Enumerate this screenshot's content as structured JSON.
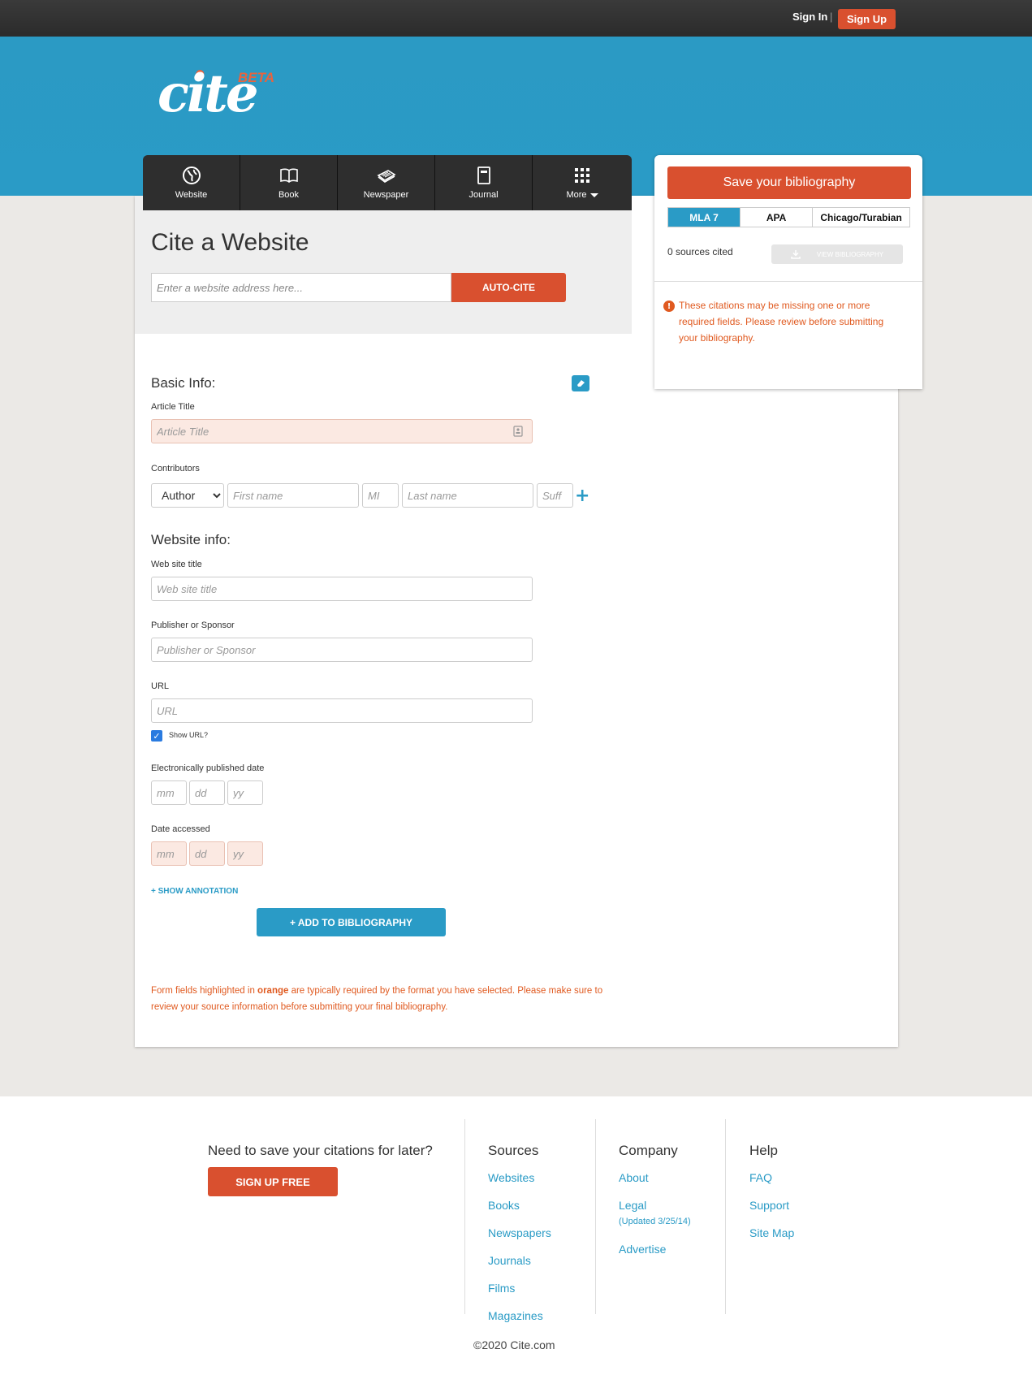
{
  "topbar": {
    "signin": "Sign In",
    "separator": "|",
    "signup": "Sign Up"
  },
  "logo": {
    "text": "cite",
    "badge": "BETA"
  },
  "nav": [
    {
      "label": "Website",
      "icon": "globe-icon"
    },
    {
      "label": "Book",
      "icon": "book-icon"
    },
    {
      "label": "Newspaper",
      "icon": "newspaper-icon"
    },
    {
      "label": "Journal",
      "icon": "journal-icon"
    },
    {
      "label": "More",
      "icon": "grid-icon"
    }
  ],
  "cite": {
    "title": "Cite a Website",
    "url_placeholder": "Enter a website address here...",
    "autocite": "AUTO-CITE"
  },
  "form": {
    "basic_info": "Basic Info:",
    "article_title_label": "Article Title",
    "article_title_placeholder": "Article Title",
    "contributors_label": "Contributors",
    "contributor_role": "Author",
    "first_name": "First name",
    "mi": "MI",
    "last_name": "Last name",
    "suffix": "Suff",
    "website_info": "Website info:",
    "site_title_label": "Web site title",
    "site_title_placeholder": "Web site title",
    "publisher_label": "Publisher or Sponsor",
    "publisher_placeholder": "Publisher or Sponsor",
    "url_label": "URL",
    "url_placeholder": "URL",
    "show_url": "Show URL?",
    "epub_label": "Electronically published date",
    "accessed_label": "Date accessed",
    "mm": "mm",
    "dd": "dd",
    "yy": "yy",
    "show_annotation": "+ SHOW ANNOTATION",
    "add_bib": "+ ADD TO BIBLIOGRAPHY",
    "note_pre": "Form fields highlighted in ",
    "note_bold": "orange",
    "note_post": " are typically required by the format you have selected. Please make sure to review your source information before submitting your final bibliography."
  },
  "sidebar": {
    "save": "Save your bibliography",
    "styles": [
      "MLA 7",
      "APA",
      "Chicago/Turabian"
    ],
    "sources": "0 sources cited",
    "view_bib": "VIEW BIBLIOGRAPHY",
    "warning": "These citations may be missing one or more required fields. Please review before submitting your bibliography."
  },
  "footer": {
    "need": "Need to save your citations for later?",
    "signup_free": "SIGN UP FREE",
    "sources_head": "Sources",
    "sources_links": [
      "Websites",
      "Books",
      "Newspapers",
      "Journals",
      "Films",
      "Magazines"
    ],
    "company_head": "Company",
    "about": "About",
    "legal": "Legal",
    "legal_sub": "(Updated 3/25/14)",
    "advertise": "Advertise",
    "help_head": "Help",
    "help_links": [
      "FAQ",
      "Support",
      "Site Map"
    ],
    "copyright": "©2020 Cite.com"
  },
  "colors": {
    "accent": "#d9502f",
    "blue": "#2a9bc6",
    "warning": "#e05a20"
  }
}
